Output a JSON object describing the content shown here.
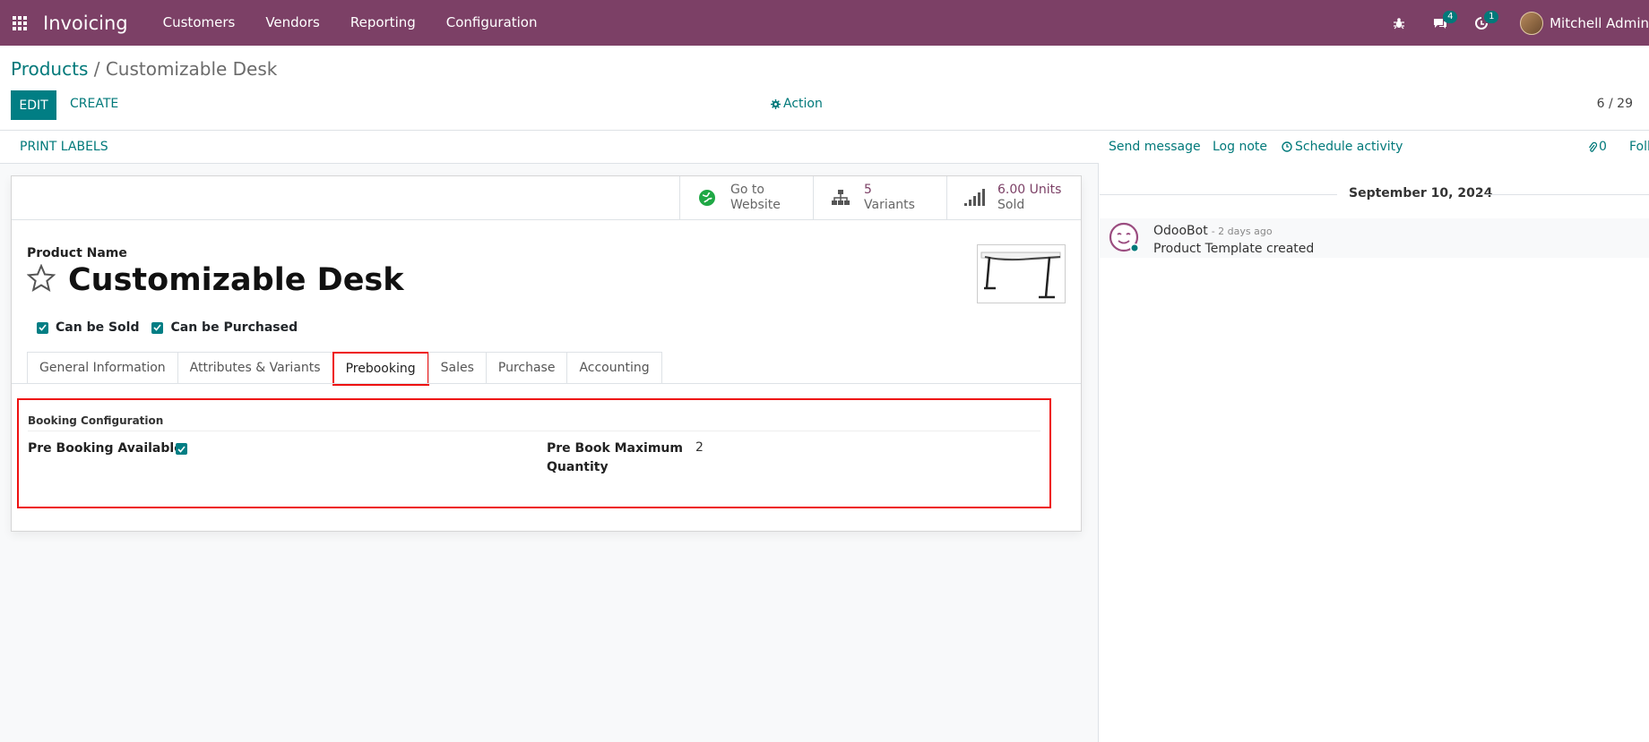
{
  "navbar": {
    "app_name": "Invoicing",
    "menu": [
      "Customers",
      "Vendors",
      "Reporting",
      "Configuration"
    ],
    "messages_badge": "4",
    "activities_badge": "1",
    "user_name": "Mitchell Admin",
    "color": "#7c4066"
  },
  "breadcrumb": {
    "parent": "Products",
    "separator": " / ",
    "current": "Customizable Desk"
  },
  "control_panel": {
    "edit_label": "EDIT",
    "create_label": "CREATE",
    "action_label": "Action",
    "pager": "6 / 29"
  },
  "status_bar": {
    "print_labels": "PRINT LABELS"
  },
  "smart_buttons": {
    "website": {
      "line1": "Go to",
      "line2": "Website"
    },
    "variants": {
      "value": "5",
      "label": "Variants"
    },
    "sold": {
      "value": "6.00 Units",
      "label": "Sold"
    }
  },
  "product": {
    "name_label": "Product Name",
    "name": "Customizable Desk",
    "can_be_sold": "Can be Sold",
    "can_be_purchased": "Can be Purchased"
  },
  "tabs": [
    "General Information",
    "Attributes & Variants",
    "Prebooking",
    "Sales",
    "Purchase",
    "Accounting"
  ],
  "active_tab": "Prebooking",
  "prebooking": {
    "group_title": "Booking Configuration",
    "pre_booking_label": "Pre Booking Available",
    "max_qty_label_1": "Pre Book Maximum",
    "max_qty_label_2": "Quantity",
    "max_qty_value": "2"
  },
  "chatter": {
    "send_message": "Send message",
    "log_note": "Log note",
    "schedule_activity": "Schedule activity",
    "attachments": "0",
    "follow": "Foll",
    "date": "September 10, 2024",
    "author": "OdooBot",
    "time_ago": "- 2 days ago",
    "body": "Product Template created"
  },
  "colors": {
    "accent": "#017e84",
    "brand": "#7c4066",
    "highlight": "#ee1111"
  }
}
